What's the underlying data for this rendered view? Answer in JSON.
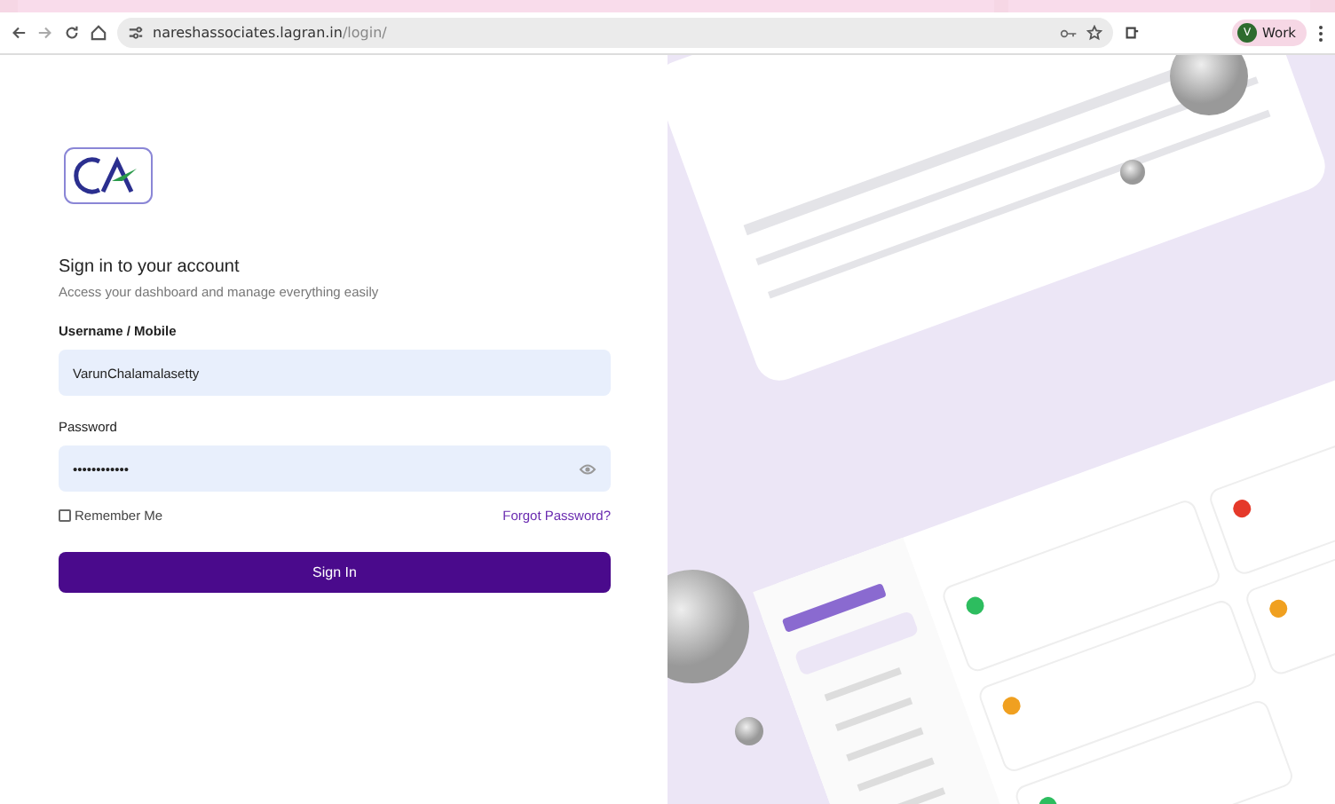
{
  "browser": {
    "url_host": "nareshassociates.lagran.in",
    "url_path": "/login/",
    "profile_initial": "V",
    "profile": "Work"
  },
  "login": {
    "heading": "Sign in to your account",
    "subheading": "Access your dashboard and manage everything easily",
    "fields": [
      {
        "kind": "text",
        "label": "Username / Mobile",
        "value": "VarunChalamalasetty"
      },
      {
        "kind": "password",
        "label": "Password",
        "value": "••••••••••••"
      }
    ],
    "remember": {
      "label": "Remember Me",
      "checked": false
    },
    "forgot": "Forgot Password?",
    "submit": "Sign In"
  }
}
